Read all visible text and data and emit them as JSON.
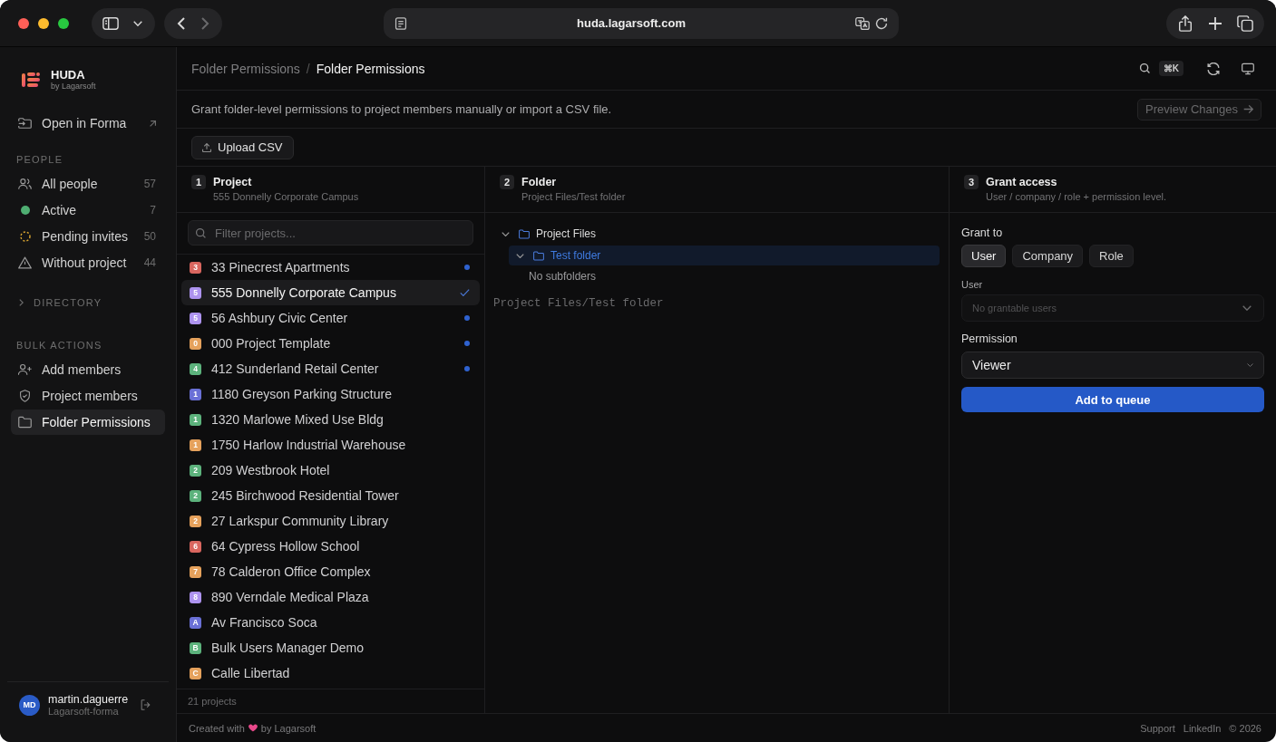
{
  "browser": {
    "url": "huda.lagarsoft.com"
  },
  "sidebar": {
    "brand": {
      "name": "HUDA",
      "tagline": "by Lagarsoft"
    },
    "open_link": {
      "label": "Open in Forma"
    },
    "sections": [
      {
        "title": "PEOPLE",
        "items": [
          {
            "label": "All people",
            "count": "57",
            "kind": "people",
            "selected": false
          },
          {
            "label": "Active",
            "count": "7",
            "kind": "active",
            "selected": false
          },
          {
            "label": "Pending invites",
            "count": "50",
            "kind": "pending",
            "selected": false
          },
          {
            "label": "Without project",
            "count": "44",
            "kind": "warning",
            "selected": false
          }
        ]
      },
      {
        "title": "DIRECTORY",
        "expanded": false
      },
      {
        "title": "BULK ACTIONS",
        "items": [
          {
            "label": "Add members",
            "kind": "add-user",
            "selected": false
          },
          {
            "label": "Project members",
            "kind": "shield",
            "selected": false
          },
          {
            "label": "Folder Permissions",
            "kind": "folder",
            "selected": true
          }
        ]
      }
    ],
    "user": {
      "initials": "MD",
      "name": "martin.daguerre",
      "org": "Lagarsoft-forma"
    }
  },
  "header": {
    "breadcrumb": [
      {
        "label": "Folder Permissions",
        "current": false
      },
      {
        "label": "Folder Permissions",
        "current": true
      }
    ],
    "separator": "/",
    "shortcut": "⌘K"
  },
  "intro": {
    "text": "Grant folder-level permissions to project members manually or import a CSV file.",
    "preview_button": {
      "label": "Preview Changes",
      "disabled": true
    }
  },
  "upload_button": {
    "label": "Upload CSV"
  },
  "steps": [
    {
      "number": "1",
      "title": "Project",
      "subtitle": "555 Donnelly Corporate Campus"
    },
    {
      "number": "2",
      "title": "Folder",
      "subtitle": "Project Files/Test folder"
    },
    {
      "number": "3",
      "title": "Grant access",
      "subtitle": "User / company / role + permission level."
    }
  ],
  "projects": {
    "filter_placeholder": "Filter projects...",
    "items": [
      {
        "badge": "3",
        "color": "#d9665f",
        "name": "33 Pinecrest Apartments",
        "selected": false,
        "marked": true
      },
      {
        "badge": "5",
        "color": "#ad93ef",
        "name": "555 Donnelly Corporate Campus",
        "selected": true,
        "marked": false
      },
      {
        "badge": "5",
        "color": "#ad93ef",
        "name": "56 Ashbury Civic Center",
        "selected": false,
        "marked": true
      },
      {
        "badge": "0",
        "color": "#e5a15c",
        "name": "000 Project Template",
        "selected": false,
        "marked": true
      },
      {
        "badge": "4",
        "color": "#5cb27c",
        "name": "412 Sunderland Retail Center",
        "selected": false,
        "marked": true
      },
      {
        "badge": "1",
        "color": "#6a70d6",
        "name": "1180 Greyson Parking Structure",
        "selected": false,
        "marked": false
      },
      {
        "badge": "1",
        "color": "#5cb27c",
        "name": "1320 Marlowe Mixed Use Bldg",
        "selected": false,
        "marked": false
      },
      {
        "badge": "1",
        "color": "#e5a15c",
        "name": "1750 Harlow Industrial Warehouse",
        "selected": false,
        "marked": false
      },
      {
        "badge": "2",
        "color": "#5cb27c",
        "name": "209 Westbrook Hotel",
        "selected": false,
        "marked": false
      },
      {
        "badge": "2",
        "color": "#5cb27c",
        "name": "245 Birchwood Residential Tower",
        "selected": false,
        "marked": false
      },
      {
        "badge": "2",
        "color": "#e5a15c",
        "name": "27 Larkspur Community Library",
        "selected": false,
        "marked": false
      },
      {
        "badge": "6",
        "color": "#d9665f",
        "name": "64 Cypress Hollow School",
        "selected": false,
        "marked": false
      },
      {
        "badge": "7",
        "color": "#e5a15c",
        "name": "78 Calderon Office Complex",
        "selected": false,
        "marked": false
      },
      {
        "badge": "8",
        "color": "#ad93ef",
        "name": "890 Verndale Medical Plaza",
        "selected": false,
        "marked": false
      },
      {
        "badge": "A",
        "color": "#6a70d6",
        "name": "Av Francisco Soca",
        "selected": false,
        "marked": false
      },
      {
        "badge": "B",
        "color": "#5cb27c",
        "name": "Bulk Users Manager Demo",
        "selected": false,
        "marked": false
      },
      {
        "badge": "C",
        "color": "#e5a15c",
        "name": "Calle Libertad",
        "selected": false,
        "marked": false
      }
    ],
    "count": "21 projects"
  },
  "folders": {
    "tree": [
      {
        "name": "Project Files",
        "expanded": true,
        "selected": false,
        "children": [
          {
            "name": "Test folder",
            "expanded": true,
            "selected": true,
            "empty_note": "No subfolders"
          }
        ]
      }
    ],
    "path": "Project Files/Test folder"
  },
  "grant": {
    "label": "Grant to",
    "options": [
      {
        "label": "User",
        "selected": true
      },
      {
        "label": "Company",
        "selected": false
      },
      {
        "label": "Role",
        "selected": false
      }
    ],
    "user_field": {
      "label": "User",
      "placeholder": "No grantable users",
      "disabled": true
    },
    "permission_field": {
      "label": "Permission",
      "value": "Viewer"
    },
    "submit": "Add to queue"
  },
  "footer": {
    "credit_prefix": "Created with",
    "credit_suffix": "by Lagarsoft",
    "links": [
      "Support",
      "LinkedIn"
    ],
    "copyright": "© 2026"
  }
}
